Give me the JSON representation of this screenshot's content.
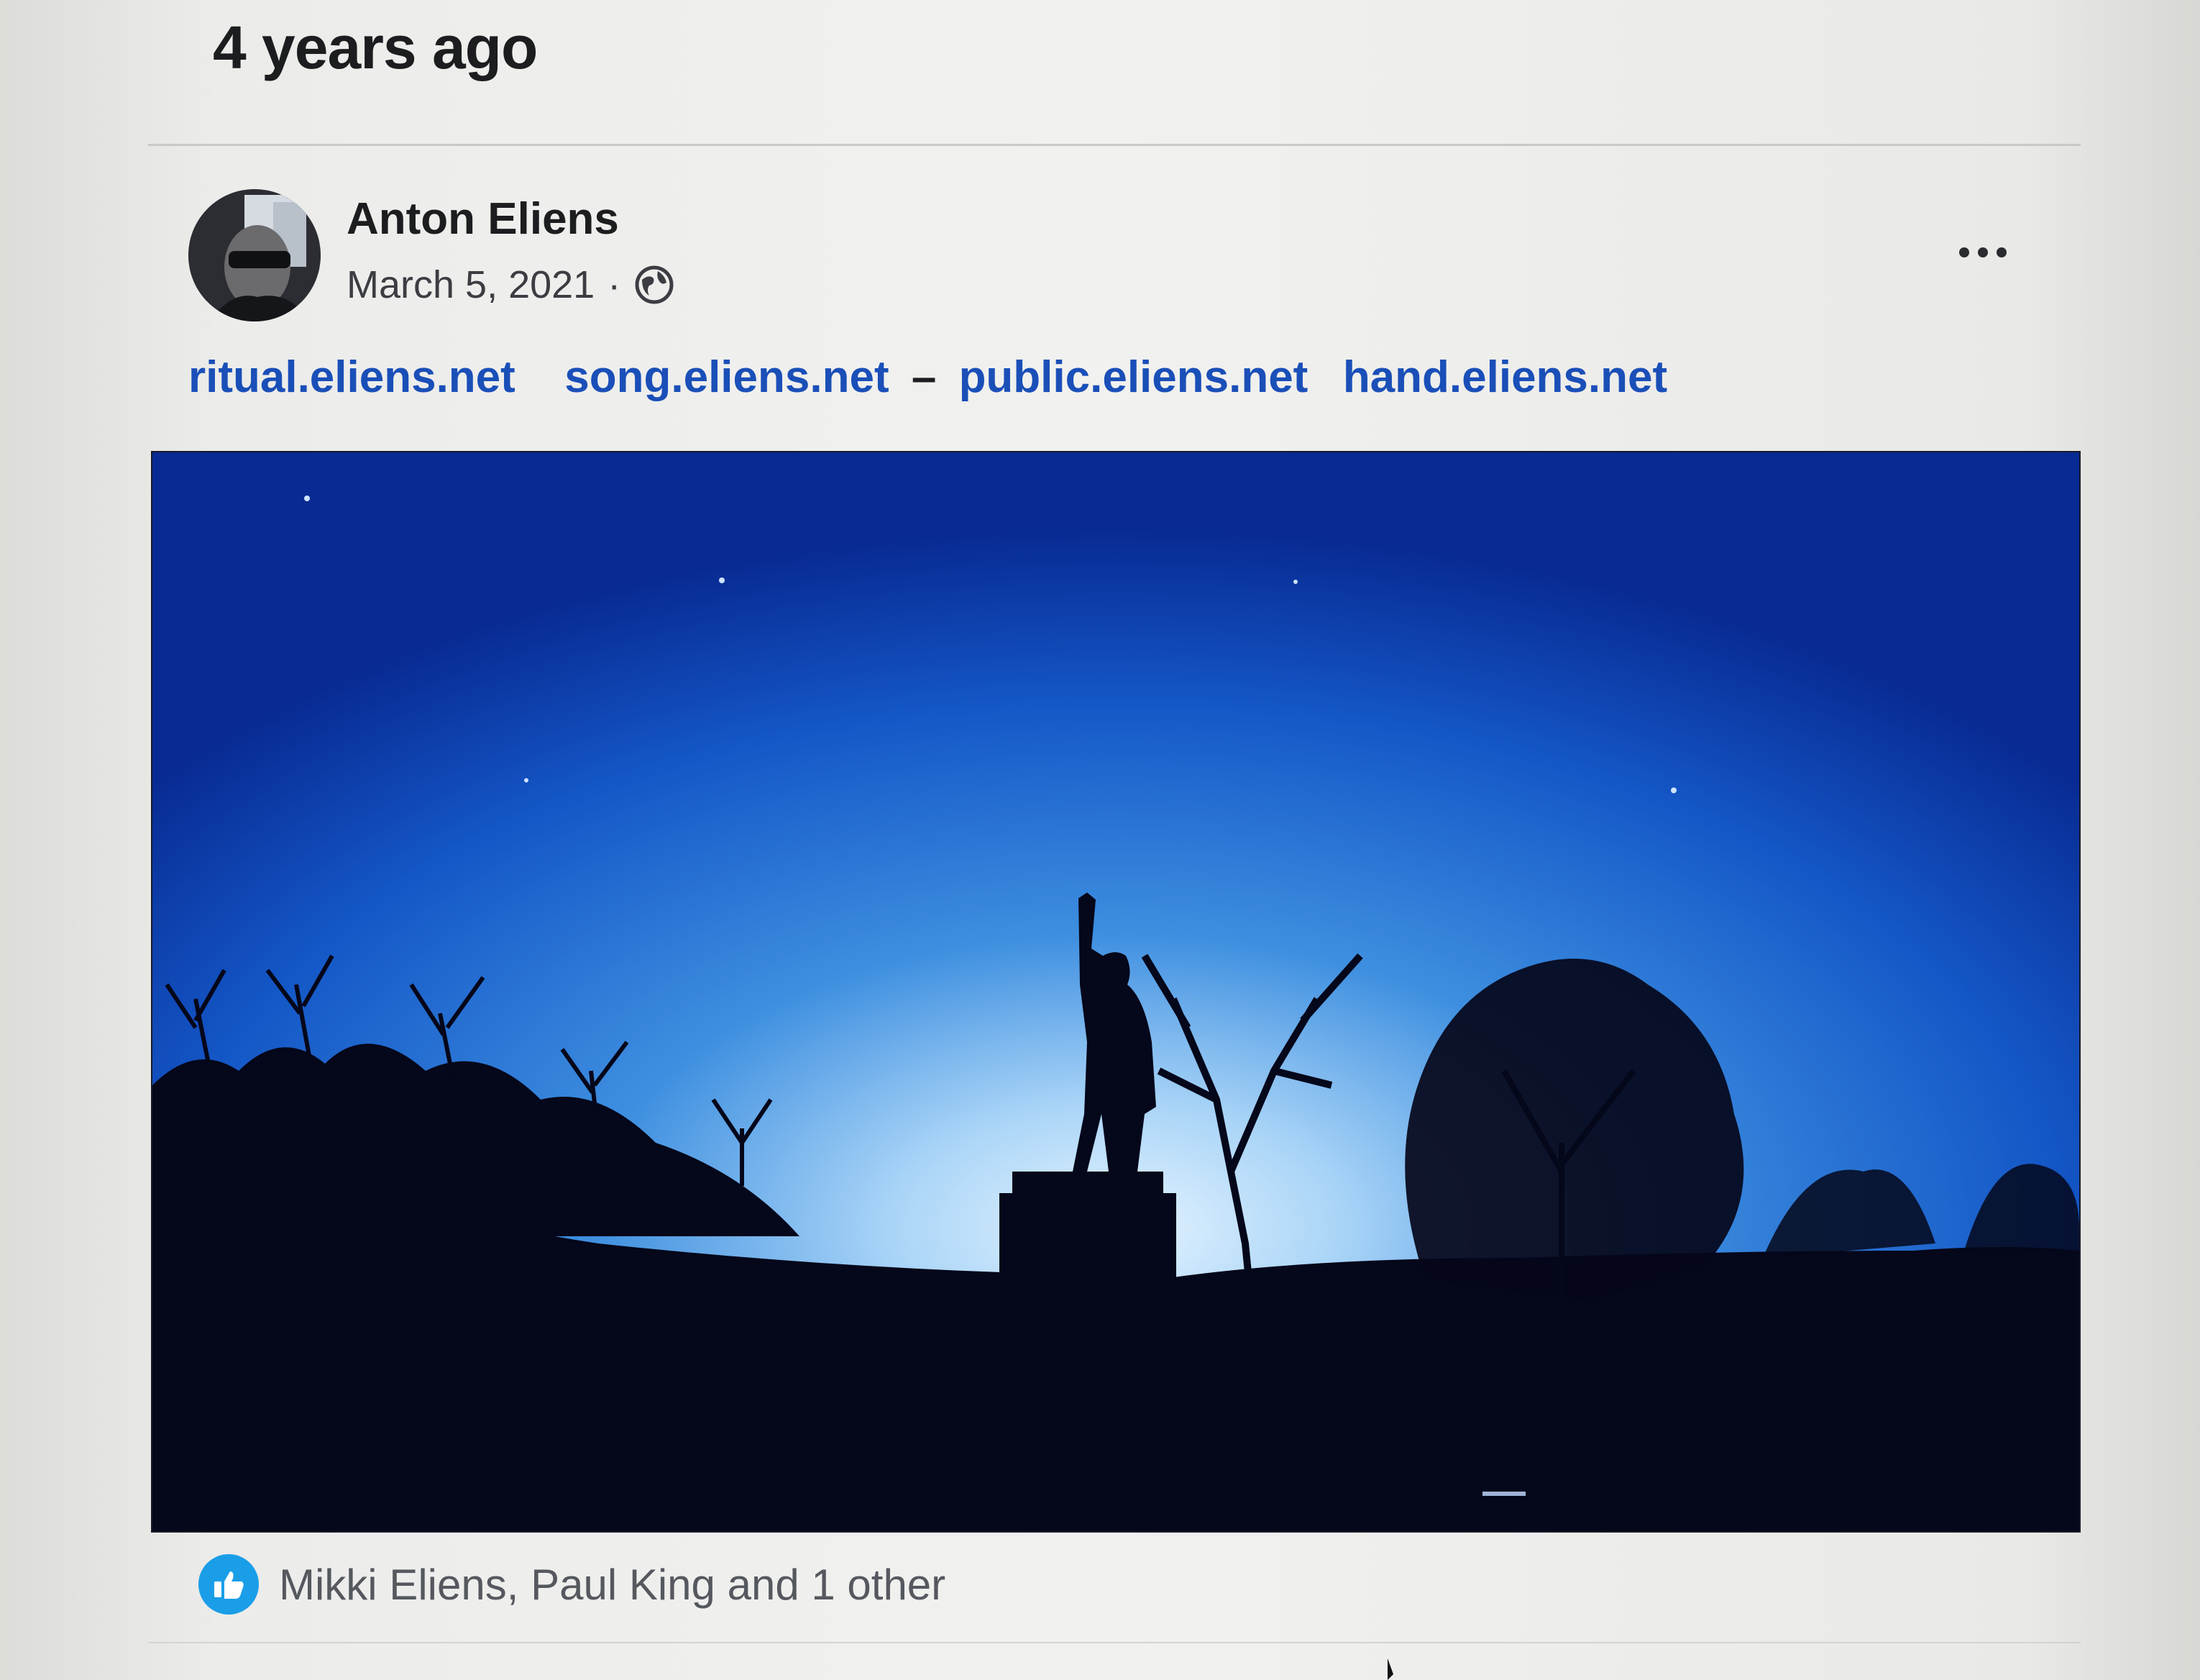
{
  "memory": {
    "header": "4 years ago"
  },
  "post": {
    "author": "Anton Eliens",
    "date": "March 5, 2021",
    "separator": "·",
    "privacy_icon": "globe-icon",
    "menu_icon": "more-options-icon",
    "links": [
      {
        "text": "ritual.eliens.net"
      },
      {
        "text": "song.eliens.net"
      },
      {
        "text": "public.eliens.net"
      },
      {
        "text": "hand.eliens.net"
      }
    ],
    "link_dash": "–",
    "photo": {
      "sky_top_color": "#0a2f9a",
      "sky_glow_color": "#d7ecff",
      "silhouette_color": "#05071a"
    },
    "reactions": {
      "icon": "thumbs-up-icon",
      "text": "Mikki Eliens, Paul King and 1 other"
    }
  },
  "colors": {
    "link": "#1a4fb8",
    "like_badge": "#1a9ee8"
  }
}
